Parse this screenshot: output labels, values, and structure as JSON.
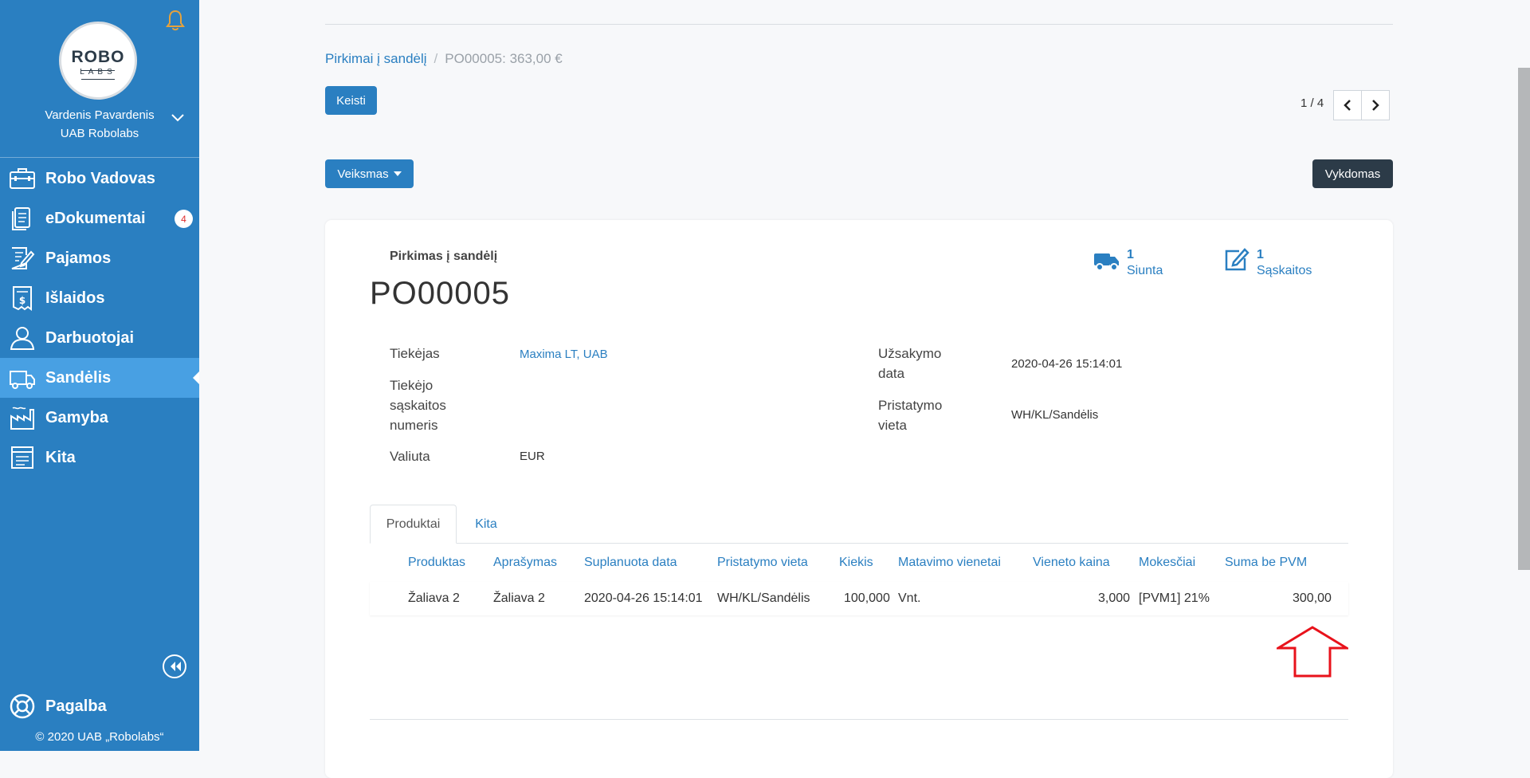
{
  "sidebar": {
    "logo": {
      "top": "ROBO",
      "bottom": "LABS"
    },
    "user_name": "Vardenis Pavardenis",
    "company": "UAB Robolabs",
    "items": [
      {
        "label": "Robo Vadovas",
        "icon": "briefcase-icon"
      },
      {
        "label": "eDokumentai",
        "icon": "documents-icon",
        "badge": "4"
      },
      {
        "label": "Pajamos",
        "icon": "invoice-edit-icon"
      },
      {
        "label": "Išlaidos",
        "icon": "receipt-icon"
      },
      {
        "label": "Darbuotojai",
        "icon": "person-icon"
      },
      {
        "label": "Sandėlis",
        "icon": "truck-icon",
        "active": true
      },
      {
        "label": "Gamyba",
        "icon": "factory-icon"
      },
      {
        "label": "Kita",
        "icon": "list-icon"
      }
    ],
    "help_label": "Pagalba",
    "copyright": "© 2020 UAB „Robolabs“"
  },
  "breadcrumb": {
    "parent": "Pirkimai į sandėlį",
    "separator": "/",
    "current": "PO00005: 363,00 €"
  },
  "toolbar": {
    "edit_label": "Keisti",
    "action_label": "Veiksmas",
    "status_label": "Vykdomas"
  },
  "pager": {
    "text": "1 / 4"
  },
  "document": {
    "subtitle": "Pirkimas į sandėlį",
    "title": "PO00005",
    "smart_buttons": [
      {
        "count": "1",
        "label": "Siunta",
        "icon": "truck-icon"
      },
      {
        "count": "1",
        "label": "Sąskaitos",
        "icon": "edit-icon"
      }
    ],
    "fields_left": {
      "supplier_label": "Tiekėjas",
      "supplier_value": "Maxima LT, UAB",
      "invoice_label": [
        "Tiekėjo",
        "sąskaitos",
        "numeris"
      ],
      "currency_label": "Valiuta",
      "currency_value": "EUR"
    },
    "fields_right": {
      "order_date_label": [
        "Užsakymo",
        "data"
      ],
      "order_date_value": "2020-04-26 15:14:01",
      "delivery_label": [
        "Pristatymo",
        "vieta"
      ],
      "delivery_value": "WH/KL/Sandėlis"
    }
  },
  "tabs": [
    {
      "label": "Produktai",
      "active": true
    },
    {
      "label": "Kita"
    }
  ],
  "table": {
    "headers": [
      "Produktas",
      "Aprašymas",
      "Suplanuota data",
      "Pristatymo vieta",
      "Kiekis",
      "Matavimo vienetai",
      "Vieneto kaina",
      "Mokesčiai",
      "Suma be PVM"
    ],
    "rows": [
      [
        "Žaliava 2",
        "Žaliava 2",
        "2020-04-26 15:14:01",
        "WH/KL/Sandėlis",
        "100,000",
        "Vnt.",
        "3,000",
        "[PVM1] 21%",
        "300,00"
      ]
    ]
  },
  "colors": {
    "sidebar": "#2a7fc1",
    "sidebar_active": "#48a0e3",
    "accent": "#2a7fc1",
    "status_dark": "#2c3b48",
    "arrow": "#e8121b",
    "bell": "#e6a23c"
  }
}
